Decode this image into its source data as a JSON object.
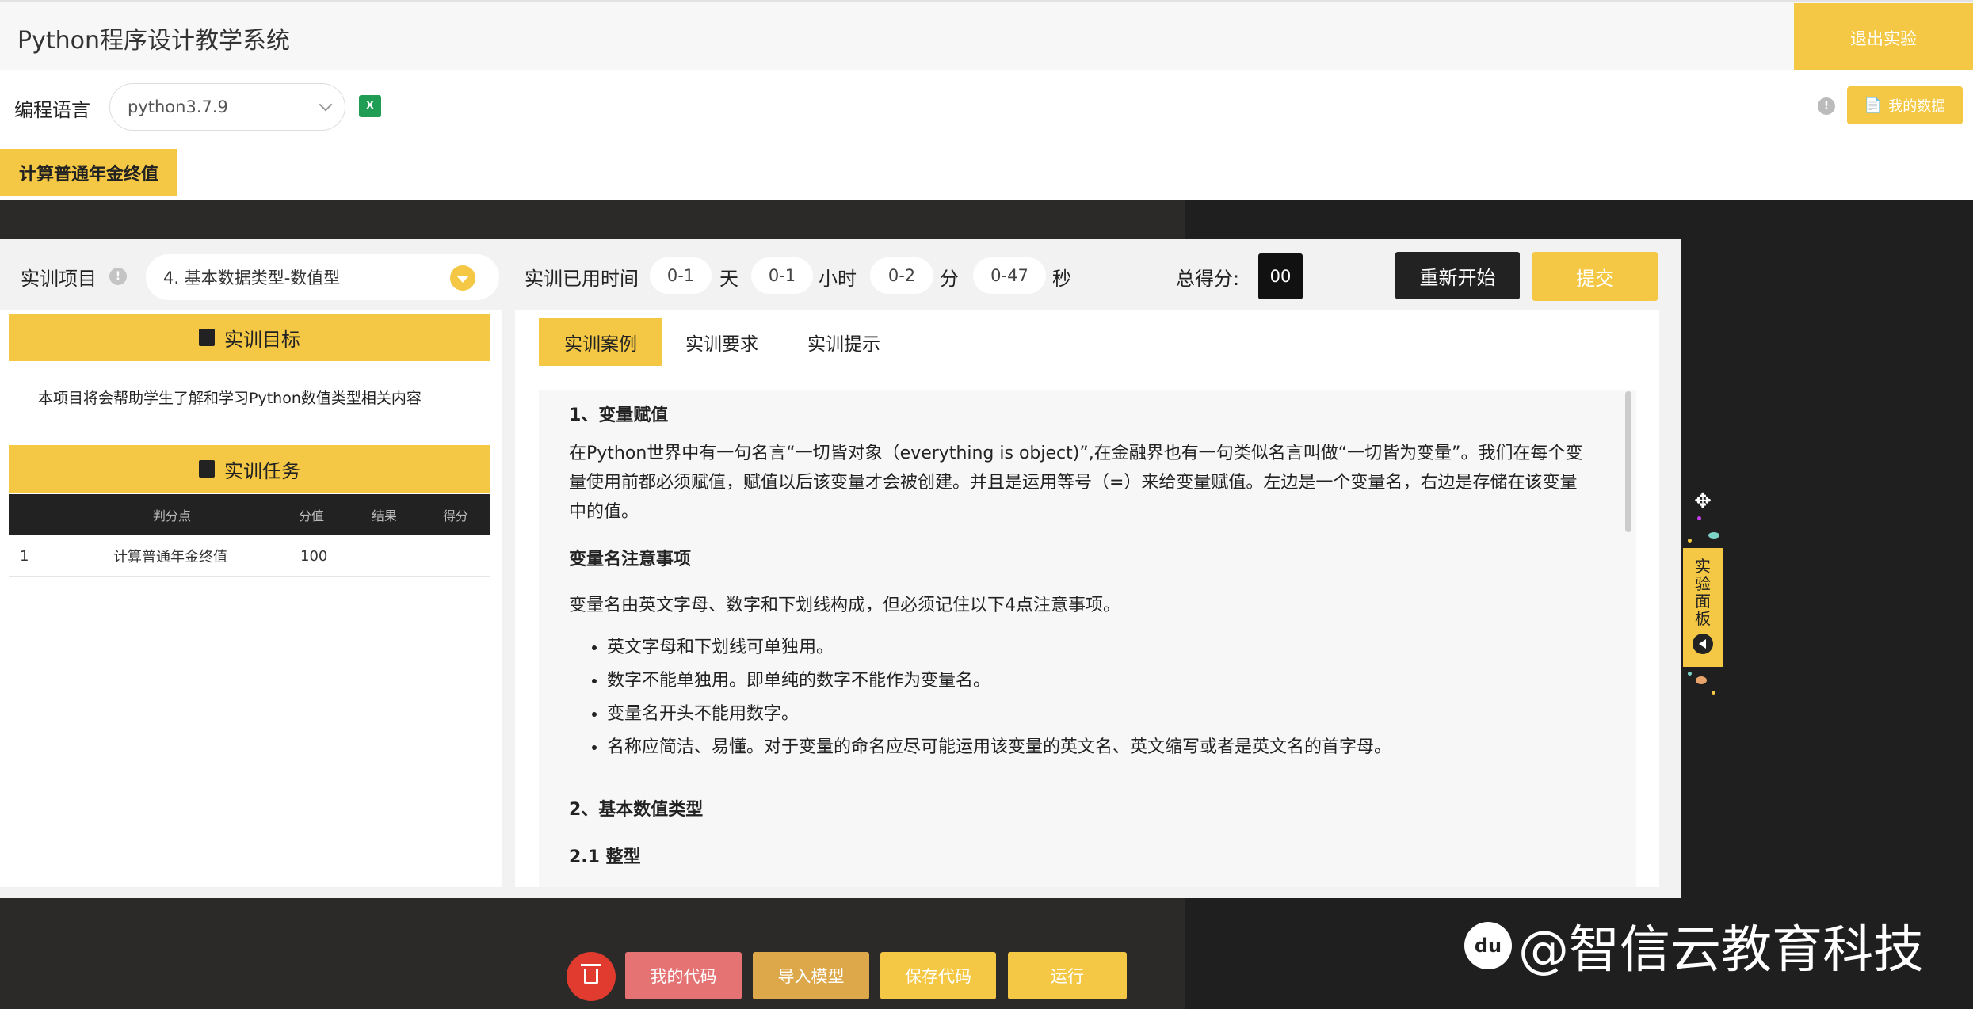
{
  "header": {
    "title": "Python程序设计教学系统",
    "exit_label": "退出实验"
  },
  "langbar": {
    "label": "编程语言",
    "selected": "python3.7.9",
    "excel_icon": "excel-icon",
    "mydata_label": "我的数据"
  },
  "case_tab": "计算普通年金终值",
  "topbar": {
    "project_label": "实训项目",
    "project_selected": "4. 基本数据类型-数值型",
    "time_label": "实训已用时间",
    "days_value": "0-1",
    "days_unit": "天",
    "hours_value": "0-1",
    "hours_unit": "小时",
    "minutes_value": "0-2",
    "minutes_unit": "分",
    "seconds_value": "0-47",
    "seconds_unit": "秒",
    "score_label": "总得分:",
    "score_value": "00",
    "restart_label": "重新开始",
    "submit_label": "提交"
  },
  "left": {
    "goal_header": "实训目标",
    "goal_desc": "本项目将会帮助学生了解和学习Python数值类型相关内容",
    "task_header": "实训任务",
    "columns": [
      "判分点",
      "分值",
      "结果",
      "得分"
    ],
    "rows": [
      {
        "index": "1",
        "point": "计算普通年金终值",
        "value": "100",
        "result": "",
        "score": ""
      }
    ]
  },
  "right": {
    "tabs": [
      "实训案例",
      "实训要求",
      "实训提示"
    ],
    "h1": "1、变量赋值",
    "p1": "在Python世界中有一句名言“一切皆对象（everything is object)”,在金融界也有一句类似名言叫做“一切皆为变量”。我们在每个变量使用前都必须赋值，赋值以后该变量才会被创建。并且是运用等号（=）来给变量赋值。左边是一个变量名，右边是存储在该变量中的值。",
    "h2": "变量名注意事项",
    "p2": "变量名由英文字母、数字和下划线构成，但必须记住以下4点注意事项。",
    "bullets": [
      "英文字母和下划线可单独用。",
      "数字不能单独用。即单纯的数字不能作为变量名。",
      "变量名开头不能用数字。",
      "名称应简洁、易懂。对于变量的命名应尽可能运用该变量的英文名、英文缩写或者是英文名的首字母。"
    ],
    "h3": "2、基本数值类型",
    "h4": "2.1 整型"
  },
  "side_panel": {
    "label_chars": [
      "实",
      "验",
      "面",
      "板"
    ]
  },
  "bottom": {
    "my_code": "我的代码",
    "import_model": "导入模型",
    "save_code": "保存代码",
    "run": "运行"
  },
  "watermark": "@智信云教育科技",
  "watermark_logo": "du",
  "colors": {
    "accent": "#f4c844",
    "dark": "#222222",
    "danger": "#e03b2e",
    "my_code_btn": "#e57373",
    "import_btn": "#dca84a"
  }
}
